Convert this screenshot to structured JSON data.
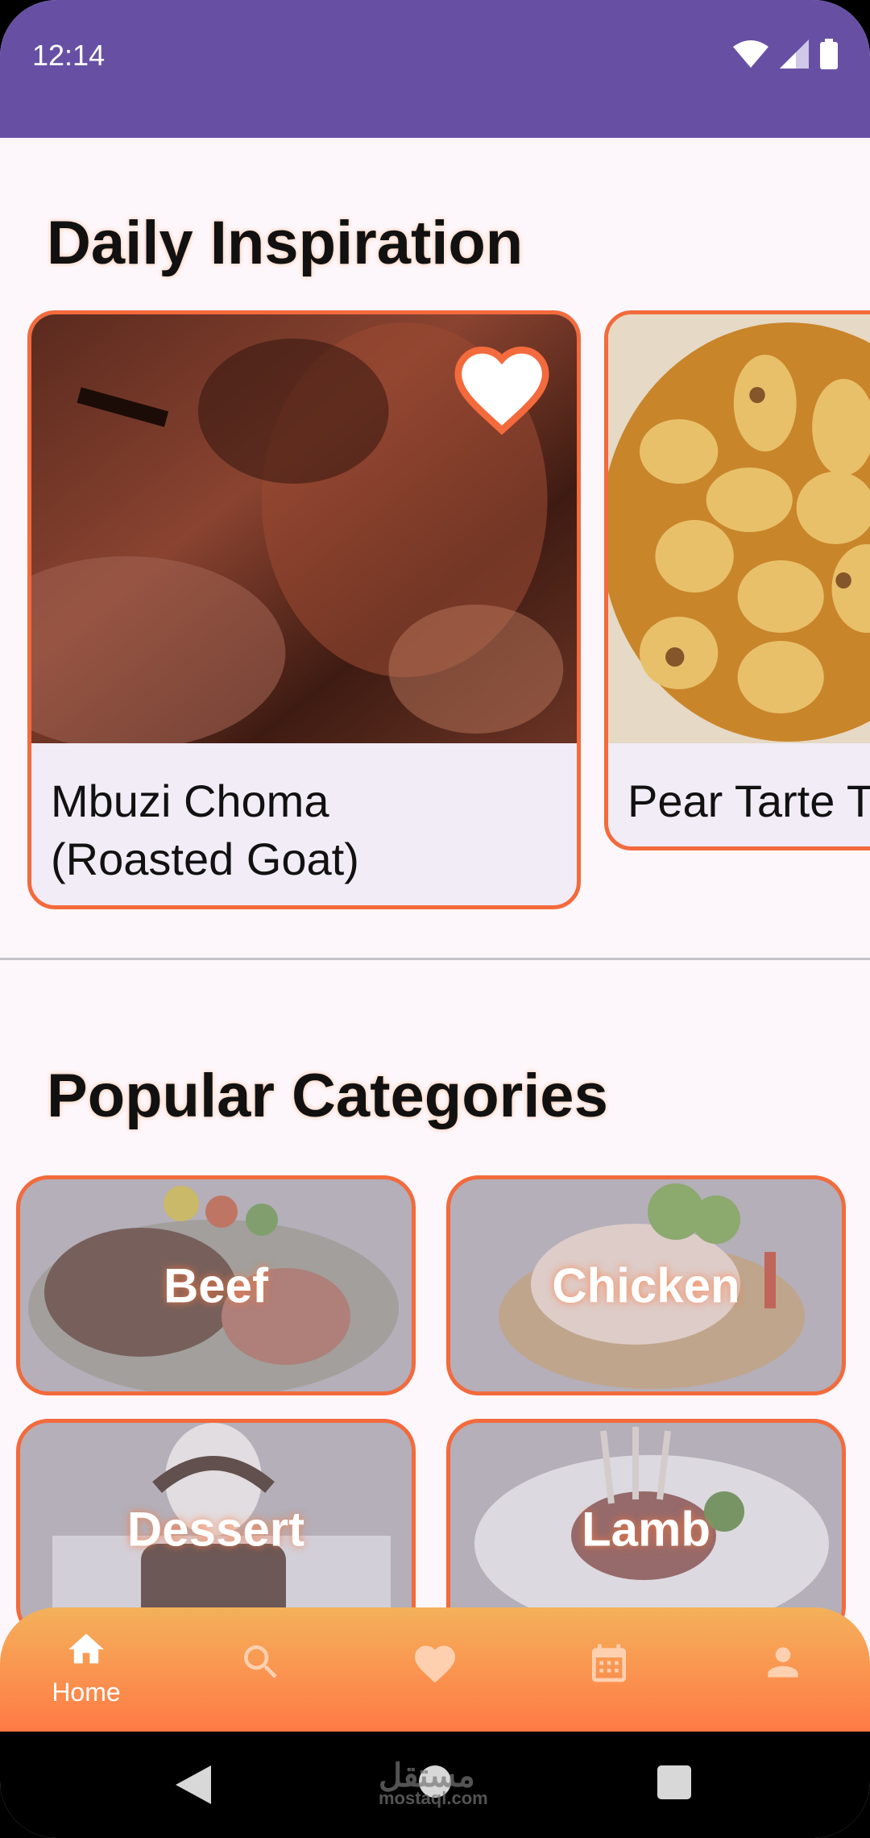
{
  "status": {
    "time": "12:14"
  },
  "inspiration": {
    "title": "Daily Inspiration",
    "cards": [
      {
        "label_line1": "Mbuzi Choma",
        "label_line2": "(Roasted Goat)",
        "favorited": true
      },
      {
        "label_line1": "Pear Tarte T",
        "label_line2": ""
      }
    ]
  },
  "categories": {
    "title": "Popular Categories",
    "items": [
      {
        "label": "Beef"
      },
      {
        "label": "Chicken"
      },
      {
        "label": "Dessert"
      },
      {
        "label": "Lamb"
      }
    ]
  },
  "bottom_nav": {
    "items": [
      {
        "icon": "home-icon",
        "label": "Home",
        "active": true
      },
      {
        "icon": "search-icon"
      },
      {
        "icon": "heart-icon"
      },
      {
        "icon": "calendar-icon"
      },
      {
        "icon": "person-icon"
      }
    ]
  },
  "watermark": {
    "text": "مستقل",
    "sub": "mostaql.com"
  },
  "colors": {
    "status_bar": "#6750a4",
    "accent": "#f36a3c",
    "nav_top": "#f4b15b",
    "nav_bottom": "#ff7a45"
  }
}
